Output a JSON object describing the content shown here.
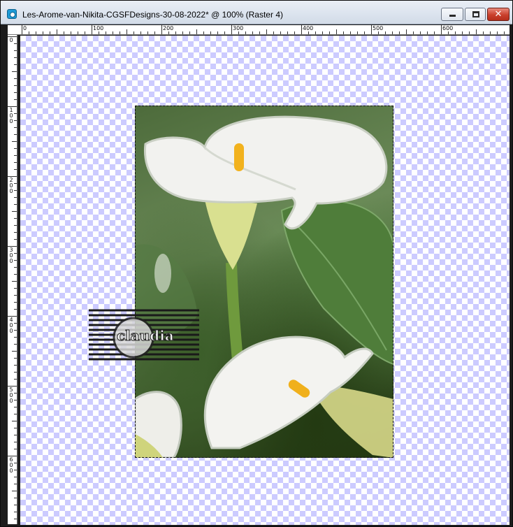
{
  "window": {
    "title": "Les-Arome-van-Nikita-CGSFDesigns-30-08-2022* @ 100% (Raster 4)",
    "icon": "paintshop-pro-icon",
    "controls": {
      "minimize_icon": "minimize-icon",
      "maximize_icon": "maximize-icon",
      "close_label": "✕"
    }
  },
  "ruler": {
    "horizontal_labels": [
      "0",
      "100",
      "200",
      "300",
      "400",
      "500",
      "600"
    ],
    "vertical_labels": [
      "0",
      "100",
      "200",
      "300",
      "400",
      "500",
      "600"
    ]
  },
  "canvas": {
    "background": "transparency-checkerboard",
    "checker_color": "#cccbff",
    "layer": "calla-lily-photo",
    "watermark_text": "claudia"
  }
}
